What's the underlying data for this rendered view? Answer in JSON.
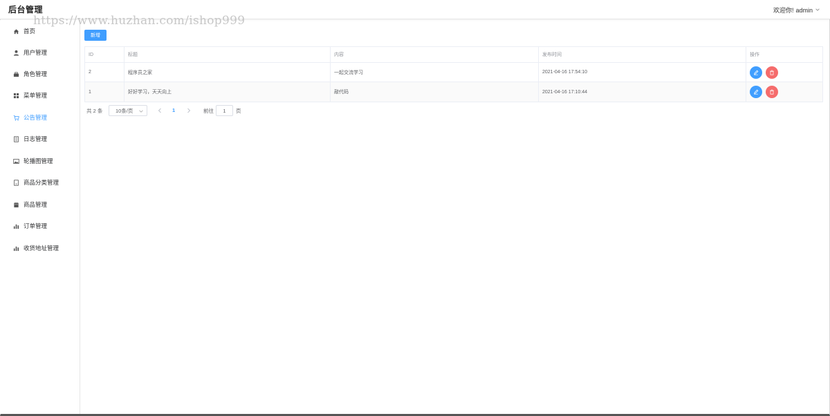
{
  "header": {
    "brand": "后台管理",
    "watermark": "https://www.huzhan.com/ishop999",
    "welcome": "欢迎你!",
    "username": "admin"
  },
  "sidebar": {
    "active_color": "#409eff",
    "items": [
      {
        "label": "首页",
        "icon": "home-icon"
      },
      {
        "label": "用户管理",
        "icon": "user-icon"
      },
      {
        "label": "角色管理",
        "icon": "role-icon"
      },
      {
        "label": "菜单管理",
        "icon": "menu-grid-icon"
      },
      {
        "label": "公告管理",
        "icon": "cart-icon",
        "active": true
      },
      {
        "label": "日志管理",
        "icon": "document-icon"
      },
      {
        "label": "轮播图管理",
        "icon": "picture-icon"
      },
      {
        "label": "商品分类管理",
        "icon": "notebook-icon"
      },
      {
        "label": "商品管理",
        "icon": "shop-icon"
      },
      {
        "label": "订单管理",
        "icon": "chart-icon"
      },
      {
        "label": "收货地址管理",
        "icon": "chart-icon"
      }
    ]
  },
  "toolbar": {
    "add_label": "新增"
  },
  "table": {
    "columns": [
      "ID",
      "标题",
      "内容",
      "发布时间",
      "操作"
    ],
    "rows": [
      {
        "id": "2",
        "title": "程序员之家",
        "content": "一起交流学习",
        "time": "2021-04-16 17:54:10"
      },
      {
        "id": "1",
        "title": "好好学习，天天向上",
        "content": "敲代码",
        "time": "2021-04-16 17:10:44"
      }
    ]
  },
  "pagination": {
    "total_label": "共 2 条",
    "page_size": "10条/页",
    "current_page": "1",
    "goto_label": "前往",
    "goto_value": "1",
    "page_unit": "页"
  }
}
